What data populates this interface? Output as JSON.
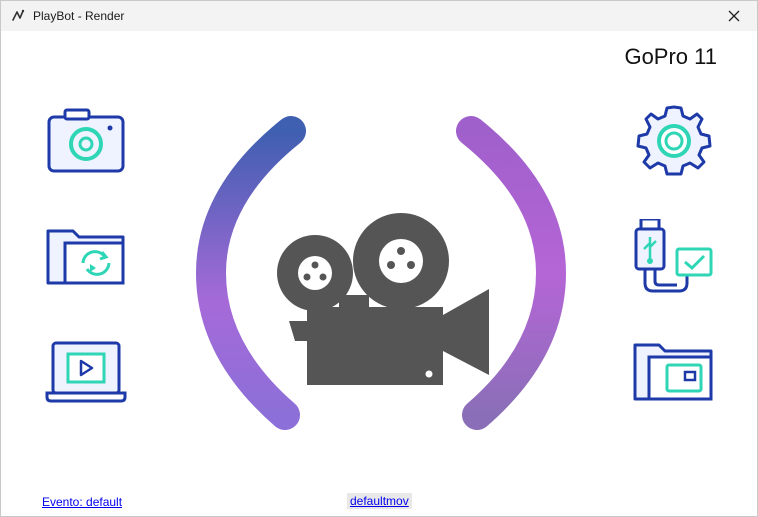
{
  "window": {
    "title": "PlayBot - Render"
  },
  "header": {
    "device_name": "GoPro 11"
  },
  "left_buttons": [
    {
      "name": "camera-icon"
    },
    {
      "name": "folder-sync-icon"
    },
    {
      "name": "laptop-play-icon"
    }
  ],
  "right_buttons": [
    {
      "name": "gear-icon"
    },
    {
      "name": "usb-check-icon"
    },
    {
      "name": "folder-wallet-icon"
    }
  ],
  "footer": {
    "evento_link": "Evento: default",
    "mov_link": "defaultmov"
  },
  "colors": {
    "icon_stroke": "#1e3aa8",
    "icon_accent": "#2fd6b6",
    "camera_gray": "#555555",
    "arc_blue": "#3f5fb0",
    "arc_purple": "#b060d8"
  }
}
